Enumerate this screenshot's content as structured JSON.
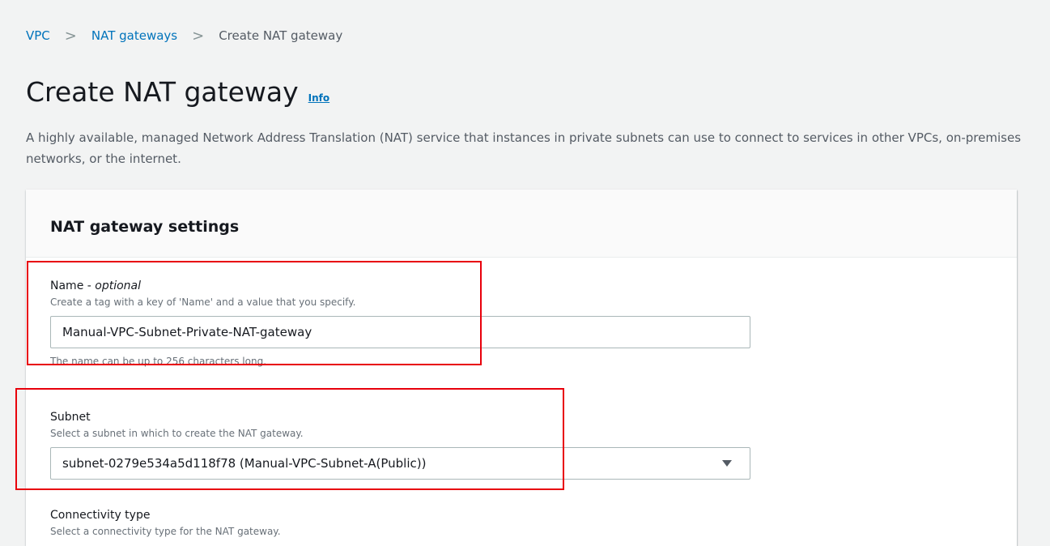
{
  "breadcrumb": {
    "items": [
      "VPC",
      "NAT gateways"
    ],
    "current": "Create NAT gateway",
    "separator": ">"
  },
  "page": {
    "title": "Create NAT gateway",
    "info": "Info",
    "description": "A highly available, managed Network Address Translation (NAT) service that instances in private subnets can use to connect to services in other VPCs, on-premises networks, or the internet."
  },
  "settings": {
    "title": "NAT gateway settings",
    "name": {
      "label": "Name -",
      "optional": "optional",
      "description": "Create a tag with a key of 'Name' and a value that you specify.",
      "value": "Manual-VPC-Subnet-Private-NAT-gateway",
      "constraint": "The name can be up to 256 characters long."
    },
    "subnet": {
      "label": "Subnet",
      "description": "Select a subnet in which to create the NAT gateway.",
      "selected": "subnet-0279e534a5d118f78 (Manual-VPC-Subnet-A(Public))"
    },
    "connectivity": {
      "label": "Connectivity type",
      "description": "Select a connectivity type for the NAT gateway."
    }
  },
  "colors": {
    "link": "#0073bb",
    "highlight": "#e8000b",
    "background": "#f2f3f3"
  },
  "icons": {
    "breadcrumb_separator": "chevron-right-icon",
    "dropdown": "caret-down-icon"
  }
}
